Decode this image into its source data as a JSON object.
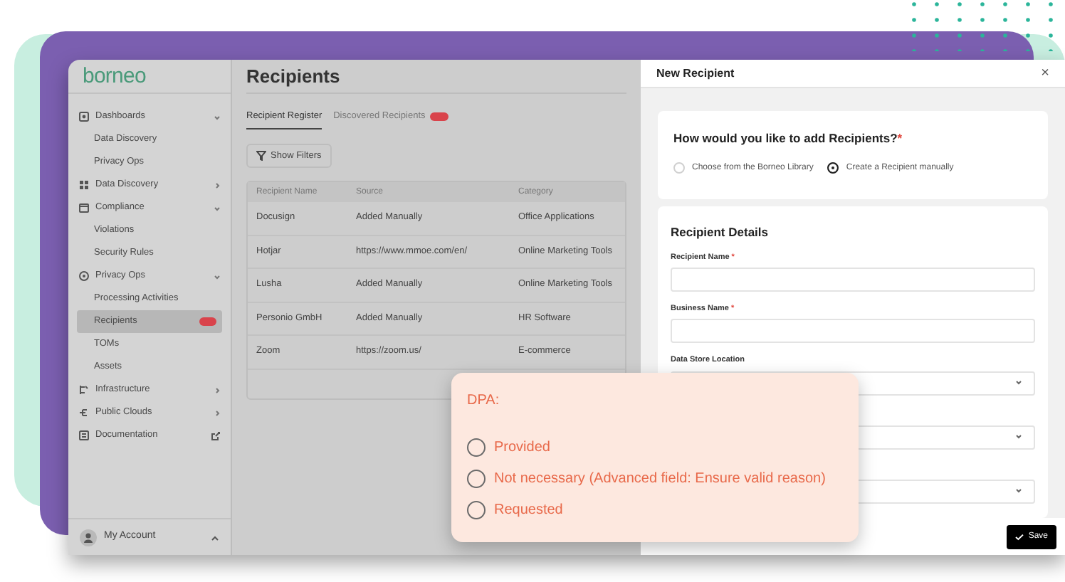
{
  "logo": "borneo",
  "sidebar": {
    "items": [
      {
        "label": "Dashboards",
        "selected": false,
        "expanded": true,
        "children": [
          {
            "label": "Data Discovery",
            "selected": false
          },
          {
            "label": "Privacy Ops",
            "selected": false
          }
        ]
      },
      {
        "label": "Data Discovery",
        "selected": false,
        "expanded": false
      },
      {
        "label": "Compliance",
        "selected": false,
        "expanded": true,
        "children": [
          {
            "label": "Violations",
            "selected": false
          },
          {
            "label": "Security Rules",
            "selected": false
          }
        ]
      },
      {
        "label": "Privacy Ops",
        "selected": false,
        "expanded": true,
        "children": [
          {
            "label": "Processing Activities",
            "selected": false
          },
          {
            "label": "Recipients",
            "selected": true,
            "badge": true
          },
          {
            "label": "TOMs",
            "selected": false
          },
          {
            "label": "Assets",
            "selected": false
          }
        ]
      },
      {
        "label": "Infrastructure",
        "selected": false,
        "expanded": false
      },
      {
        "label": "Public Clouds",
        "selected": false,
        "expanded": false
      },
      {
        "label": "Documentation",
        "selected": false,
        "external": true
      }
    ],
    "account": "My Account"
  },
  "page": {
    "title": "Recipients",
    "tabs": [
      {
        "label": "Recipient Register",
        "selected": true,
        "badge": false
      },
      {
        "label": "Discovered Recipients",
        "selected": false,
        "badge": true
      }
    ],
    "filter_button": "Show Filters",
    "table": {
      "columns": [
        "Recipient Name",
        "Source",
        "Category"
      ],
      "rows": [
        [
          "Docusign",
          "Added Manually",
          "Office Applications"
        ],
        [
          "Hotjar",
          "https://www.mmoe.com/en/",
          "Online Marketing Tools"
        ],
        [
          "Lusha",
          "Added Manually",
          "Online Marketing Tools"
        ],
        [
          "Personio GmbH",
          "Added Manually",
          "HR Software"
        ],
        [
          "Zoom",
          "https://zoom.us/",
          "E-commerce"
        ]
      ]
    }
  },
  "drawer": {
    "title": "New Recipient",
    "close": "×",
    "question": "How would you like to add Recipients?",
    "question_required": "*",
    "options": [
      {
        "label": "Choose from the Borneo Library",
        "selected": false
      },
      {
        "label": "Create a Recipient manually",
        "selected": true
      }
    ],
    "section_title": "Recipient Details",
    "fields": [
      {
        "kind": "text",
        "label": "Recipient Name",
        "required": true
      },
      {
        "kind": "text",
        "label": "Business Name",
        "required": true
      },
      {
        "kind": "select",
        "label": "Data Store Location",
        "required": false
      },
      {
        "kind": "select"
      },
      {
        "kind": "select"
      }
    ],
    "save_button": "Save"
  },
  "popover": {
    "title": "DPA:",
    "options": [
      {
        "label": "Provided",
        "selected": false
      },
      {
        "label": "Not necessary (Advanced field: Ensure valid reason)",
        "selected": false
      },
      {
        "label": "Requested",
        "selected": false
      }
    ]
  }
}
